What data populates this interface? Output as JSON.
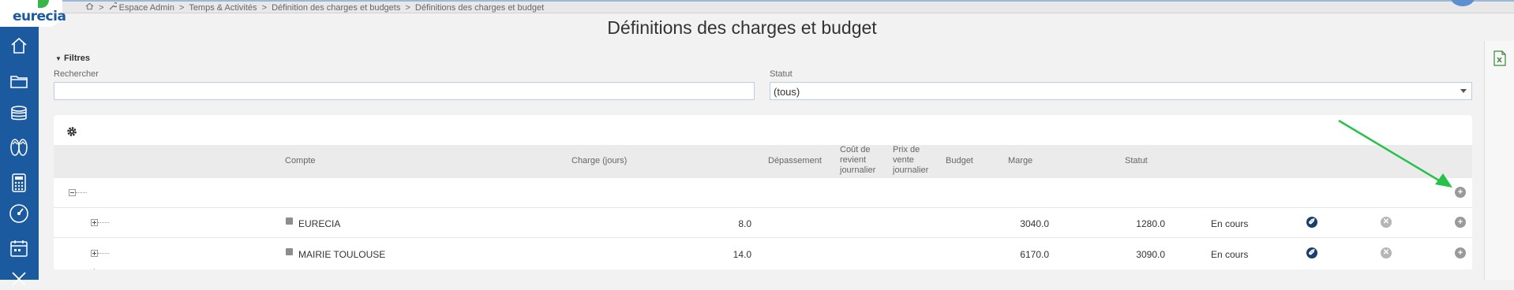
{
  "app": {
    "logo_text": "eurecia",
    "brand_color": "#1c5aa0",
    "accent_color": "#3ab54a"
  },
  "sidebar": {
    "items": [
      {
        "icon": "home-icon"
      },
      {
        "icon": "folder-icon"
      },
      {
        "icon": "coins-icon"
      },
      {
        "icon": "flip-flops-icon"
      },
      {
        "icon": "calculator-icon"
      },
      {
        "icon": "dashboard-icon"
      },
      {
        "icon": "calendar-icon"
      },
      {
        "icon": "x-icon"
      }
    ]
  },
  "breadcrumb": {
    "home_sep": ">",
    "items": [
      "Espace Admin",
      "Temps & Activités",
      "Définition des charges et budgets",
      "Définitions des charges et budget"
    ]
  },
  "page": {
    "title": "Définitions des charges et budget"
  },
  "filters": {
    "toggle_label": "Filtres",
    "search_label": "Rechercher",
    "search_value": "",
    "status_label": "Statut",
    "status_value": "(tous)"
  },
  "table": {
    "headers": {
      "compte": "Compte",
      "charge": "Charge (jours)",
      "depassement": "Dépassement",
      "cout_1": "Coût de",
      "cout_2": "revient",
      "cout_3": "journalier",
      "prix_1": "Prix de",
      "prix_2": "vente",
      "prix_3": "journalier",
      "budget": "Budget",
      "marge": "Marge",
      "statut": "Statut"
    },
    "rows": [
      {
        "compte": "EURECIA",
        "charge": "8.0",
        "budget": "3040.0",
        "marge": "1280.0",
        "statut": "En cours"
      },
      {
        "compte": "MAIRIE TOULOUSE",
        "charge": "14.0",
        "budget": "6170.0",
        "marge": "3090.0",
        "statut": "En cours"
      }
    ],
    "annotation_arrow_color": "#27c24c"
  }
}
